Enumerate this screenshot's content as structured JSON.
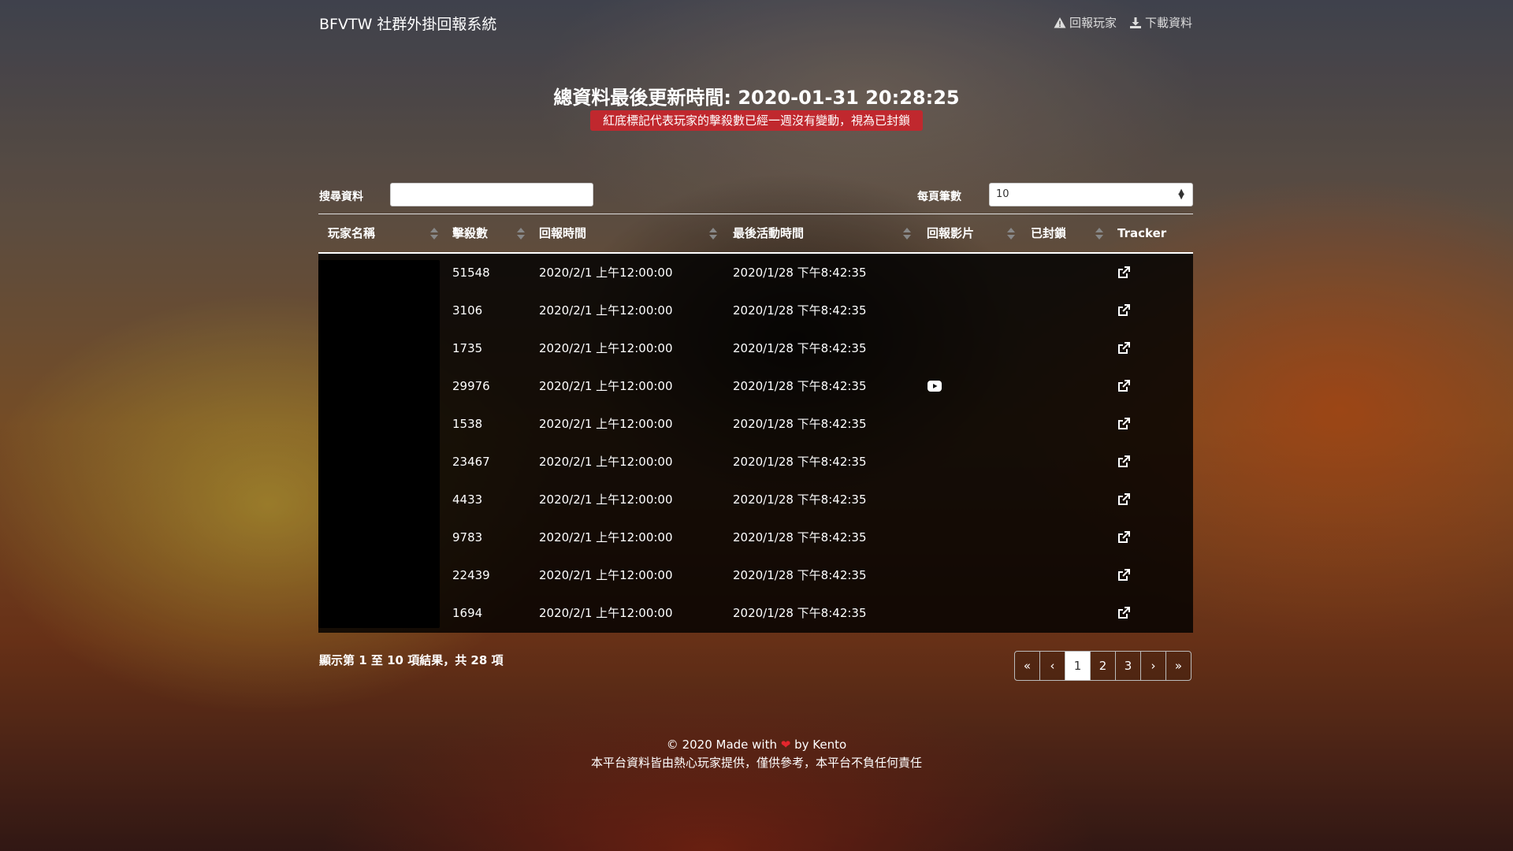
{
  "navbar": {
    "brand": "BFVTW 社群外掛回報系統",
    "report_label": "回報玩家",
    "download_label": "下載資料"
  },
  "header": {
    "title": "總資料最後更新時間: 2020-01-31 20:28:25",
    "notice": "紅底標記代表玩家的擊殺數已經一週沒有變動，視為已封鎖",
    "notice_color": "#c0282e"
  },
  "controls": {
    "search_label": "搜尋資料",
    "search_value": "",
    "page_size_label": "每頁筆數",
    "page_size_value": "10"
  },
  "table": {
    "columns": [
      "玩家名稱",
      "擊殺數",
      "回報時間",
      "最後活動時間",
      "回報影片",
      "已封鎖",
      "Tracker"
    ],
    "rows": [
      {
        "kills": "51548",
        "report_time": "2020/2/1 上午12:00:00",
        "last_active": "2020/1/28 下午8:42:35",
        "video": false
      },
      {
        "kills": "3106",
        "report_time": "2020/2/1 上午12:00:00",
        "last_active": "2020/1/28 下午8:42:35",
        "video": false
      },
      {
        "kills": "1735",
        "report_time": "2020/2/1 上午12:00:00",
        "last_active": "2020/1/28 下午8:42:35",
        "video": false
      },
      {
        "kills": "29976",
        "report_time": "2020/2/1 上午12:00:00",
        "last_active": "2020/1/28 下午8:42:35",
        "video": true
      },
      {
        "kills": "1538",
        "report_time": "2020/2/1 上午12:00:00",
        "last_active": "2020/1/28 下午8:42:35",
        "video": false
      },
      {
        "kills": "23467",
        "report_time": "2020/2/1 上午12:00:00",
        "last_active": "2020/1/28 下午8:42:35",
        "video": false
      },
      {
        "kills": "4433",
        "report_time": "2020/2/1 上午12:00:00",
        "last_active": "2020/1/28 下午8:42:35",
        "video": false
      },
      {
        "kills": "9783",
        "report_time": "2020/2/1 上午12:00:00",
        "last_active": "2020/1/28 下午8:42:35",
        "video": false
      },
      {
        "kills": "22439",
        "report_time": "2020/2/1 上午12:00:00",
        "last_active": "2020/1/28 下午8:42:35",
        "video": false
      },
      {
        "kills": "1694",
        "report_time": "2020/2/1 上午12:00:00",
        "last_active": "2020/1/28 下午8:42:35",
        "video": false
      }
    ]
  },
  "footer_info": {
    "summary": "顯示第 1 至 10 項結果，共 28 項"
  },
  "pagination": {
    "buttons": [
      "«",
      "‹",
      "1",
      "2",
      "3",
      "›",
      "»"
    ],
    "active": "1"
  },
  "footer": {
    "line1_before": "© 2020 Made with",
    "line1_after": "by Kento",
    "line2": "本平台資料皆由熱心玩家提供，僅供參考，本平台不負任何責任"
  }
}
